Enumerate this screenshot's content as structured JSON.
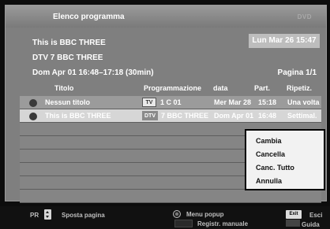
{
  "header": {
    "title": "Elenco programma",
    "brand": "DVD"
  },
  "info": {
    "programme": "This is BBC THREE",
    "channel": "DTV 7 BBC THREE",
    "slot": "Dom Apr 01 16:48–17:18 (30min)",
    "datetime": "Lun Mar 26 15:47",
    "page": "Pagina 1/1"
  },
  "table": {
    "columns": {
      "title": "Titolo",
      "schedule": "Programmazione",
      "date": "data",
      "start": "Part.",
      "repeat": "Ripetiz."
    },
    "rows": [
      {
        "title": "Nessun titolo",
        "source": "TV",
        "channel": "1 C 01",
        "date": "Mer Mar 28",
        "start": "15:18",
        "repeat": "Una volta"
      },
      {
        "title": "This is BBC THREE",
        "source": "DTV",
        "channel": "7 BBC THREE",
        "date": "Dom Apr 01",
        "start": "16:48",
        "repeat": "Settimal."
      }
    ]
  },
  "popup": {
    "items": [
      "Cambia",
      "Cancella",
      "Canc. Tutto",
      "Annulla"
    ]
  },
  "footer": {
    "pr": "PR",
    "page_nav": "Sposta pagina",
    "menu_popup": "Menu popup",
    "manual_rec": "Registr. manuale",
    "exit_key": "Exit",
    "exit": "Esci",
    "guide": "Guida"
  }
}
